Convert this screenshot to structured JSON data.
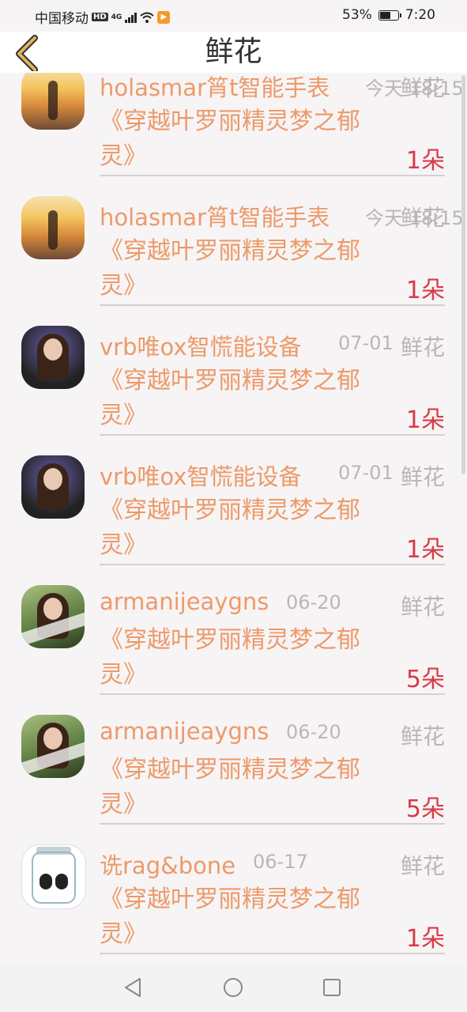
{
  "status_bar": {
    "carrier": "中国移动",
    "hd": "HD",
    "network": "4G",
    "battery": "53%",
    "battery_level": 0.53,
    "time": "7:20"
  },
  "title_bar": {
    "title": "鲜花"
  },
  "items": [
    {
      "name": "holasmar筲t智能手表",
      "date": "今天 18:15",
      "tag": "鲜花",
      "book": "《穿越叶罗丽精灵梦之郁灵》",
      "count": "1朵",
      "avatar": "sunset-silhouette"
    },
    {
      "name": "holasmar筲t智能手表",
      "date": "今天 18:15",
      "tag": "鲜花",
      "book": "《穿越叶罗丽精灵梦之郁灵》",
      "count": "1朵",
      "avatar": "sunset-silhouette"
    },
    {
      "name": "vrb唯ox智慌能设备",
      "date": "07-01",
      "tag": "鲜花",
      "book": "《穿越叶罗丽精灵梦之郁灵》",
      "count": "1朵",
      "avatar": "dj-girl"
    },
    {
      "name": "vrb唯ox智慌能设备",
      "date": "07-01",
      "tag": "鲜花",
      "book": "《穿越叶罗丽精灵梦之郁灵》",
      "count": "1朵",
      "avatar": "dj-girl"
    },
    {
      "name": "armanijeaygns",
      "date": "06-20",
      "tag": "鲜花",
      "book": "《穿越叶罗丽精灵梦之郁灵》",
      "count": "5朵",
      "avatar": "girl-green"
    },
    {
      "name": "armanijeaygns",
      "date": "06-20",
      "tag": "鲜花",
      "book": "《穿越叶罗丽精灵梦之郁灵》",
      "count": "5朵",
      "avatar": "girl-green"
    },
    {
      "name": "诜rag&bone",
      "date": "06-17",
      "tag": "鲜花",
      "book": "《穿越叶罗丽精灵梦之郁灵》",
      "count": "1朵",
      "avatar": "glass-jar"
    }
  ],
  "colors": {
    "name": "#ec9a6a",
    "count": "#d83a4a",
    "muted": "#b9b6b7",
    "back": "#e0b45a"
  },
  "nav": {
    "back": "back-triangle-icon",
    "home": "home-circle-icon",
    "recents": "recents-square-icon"
  }
}
